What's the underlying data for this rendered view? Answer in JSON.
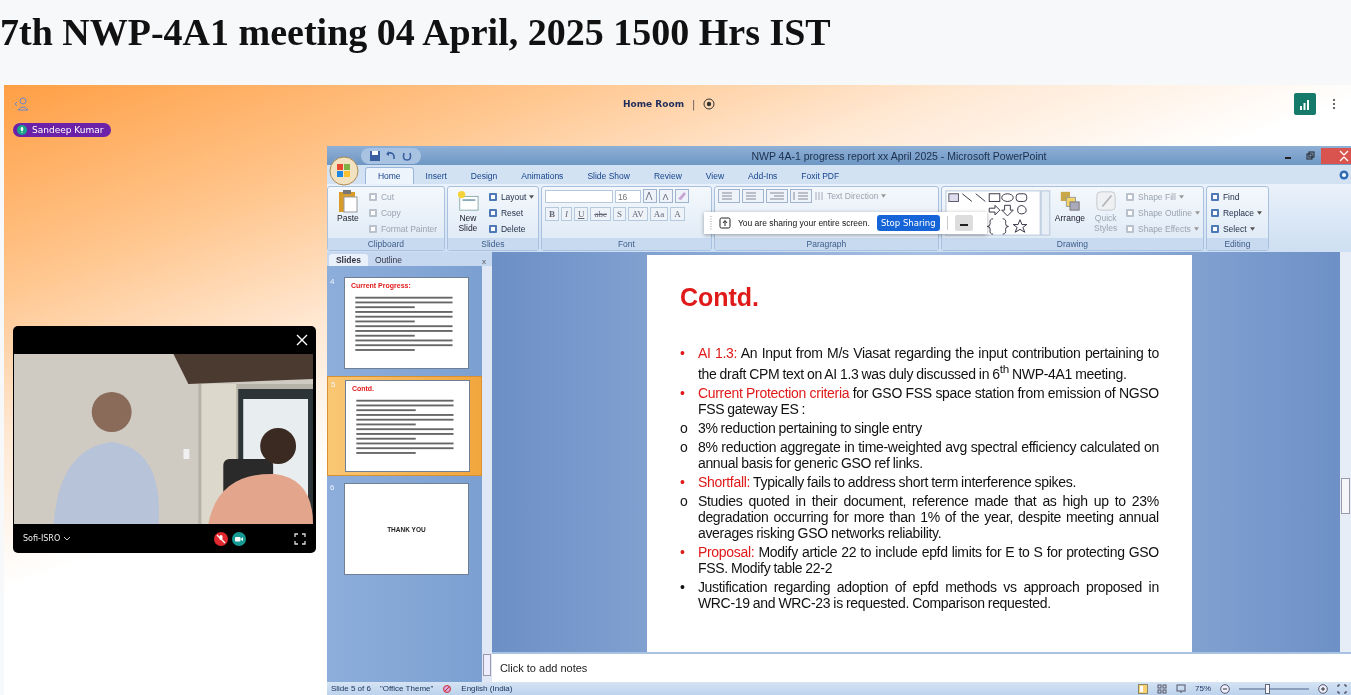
{
  "page_title": "7th NWP-4A1 meeting 04 April, 2025 1500 Hrs IST",
  "meeting": {
    "room": "Home Room",
    "separator": "|",
    "speaker": "Sandeep Kumar",
    "video_tile": {
      "name": "Sofi-ISRO",
      "mic_muted": true
    }
  },
  "powerpoint": {
    "title": "NWP 4A-1 progress report xx April 2025 - Microsoft PowerPoint",
    "tabs": [
      {
        "label": "Home",
        "selected": true
      },
      {
        "label": "Insert",
        "selected": false
      },
      {
        "label": "Design",
        "selected": false
      },
      {
        "label": "Animations",
        "selected": false
      },
      {
        "label": "Slide Show",
        "selected": false
      },
      {
        "label": "Review",
        "selected": false
      },
      {
        "label": "View",
        "selected": false
      },
      {
        "label": "Add-Ins",
        "selected": false
      },
      {
        "label": "Foxit PDF",
        "selected": false
      }
    ],
    "ribbon": [
      {
        "kind": "clipboard",
        "label": "Clipboard",
        "big": "Paste",
        "items": [
          {
            "label": "Cut",
            "disabled": true,
            "menu": false
          },
          {
            "label": "Copy",
            "disabled": true,
            "menu": false
          },
          {
            "label": "Format Painter",
            "disabled": true,
            "menu": false
          }
        ]
      },
      {
        "kind": "slides",
        "label": "Slides",
        "big": "New Slide",
        "items": [
          {
            "label": "Layout",
            "disabled": false,
            "menu": true
          },
          {
            "label": "Reset",
            "disabled": false,
            "menu": false
          },
          {
            "label": "Delete",
            "disabled": false,
            "menu": false
          }
        ]
      },
      {
        "kind": "font",
        "label": "Font",
        "size": "16",
        "buttons": [
          "B",
          "I",
          "U",
          "abe",
          "S",
          "AV",
          "Aa",
          "A"
        ]
      },
      {
        "kind": "paragraph",
        "label": "Paragraph",
        "items": [
          {
            "label": "Text Direction",
            "disabled": true,
            "menu": true
          }
        ]
      },
      {
        "kind": "drawing",
        "label": "Drawing",
        "arrange": "Arrange",
        "quick": "Quick Styles",
        "items": [
          {
            "label": "Shape Fill",
            "disabled": true,
            "menu": true
          },
          {
            "label": "Shape Outline",
            "disabled": true,
            "menu": true
          },
          {
            "label": "Shape Effects",
            "disabled": true,
            "menu": true
          }
        ]
      },
      {
        "kind": "editing",
        "label": "Editing",
        "items": [
          {
            "label": "Find",
            "disabled": false,
            "menu": false
          },
          {
            "label": "Replace",
            "disabled": false,
            "menu": true
          },
          {
            "label": "Select",
            "disabled": false,
            "menu": true
          }
        ]
      }
    ],
    "sharing": {
      "message": "You are sharing your entire screen.",
      "stop": "Stop Sharing"
    },
    "pane": {
      "tabs": [
        {
          "label": "Slides",
          "selected": true
        },
        {
          "label": "Outline",
          "selected": false
        }
      ],
      "close": "x",
      "thumbs": [
        {
          "number": "4",
          "title": "Current Progress:",
          "kind": "text",
          "selected": false
        },
        {
          "number": "5",
          "title": "Contd.",
          "kind": "text",
          "selected": true
        },
        {
          "number": "6",
          "title": "THANK YOU",
          "kind": "center",
          "selected": false
        }
      ]
    },
    "slide": {
      "title": "Contd.",
      "bullets": [
        {
          "marker": "•",
          "lead": "AI 1.3:",
          "text": "An Input from M/s Viasat regarding the input contribution pertaining to the draft CPM text on AI 1.3 was duly discussed in 6$^{th}$ NWP-4A1 meeting."
        },
        {
          "marker": "•",
          "lead": "Current Protection criteria",
          "text": "for GSO FSS space station from emission of NGSO FSS gateway ES :"
        },
        {
          "marker": "o",
          "text": "3% reduction pertaining to single entry"
        },
        {
          "marker": "o",
          "text": "8% reduction aggregate in time-weighted avg spectral efficiency calculated on annual basis for generic GSO ref links."
        },
        {
          "marker": "•",
          "lead": "Shortfall:",
          "text": "Typically fails to address short term interference spikes."
        },
        {
          "marker": "o",
          "text": "Studies quoted in their document, reference made that as high up to 23% degradation occurring for more than 1% of the year, despite meeting annual averages risking GSO networks reliability."
        },
        {
          "marker": "•",
          "lead": "Proposal:",
          "text": "Modify article 22 to include epfd limits for E to S for protecting GSO FSS. Modify table 22-2"
        },
        {
          "marker": "•",
          "text": "Justification regarding adoption of epfd methods vs approach proposed in WRC-19 and WRC-23 is requested. Comparison requested."
        }
      ]
    },
    "notes": {
      "placeholder": "Click to add notes"
    },
    "status": {
      "items": [
        "Slide 5 of 6",
        "\"Office Theme\""
      ],
      "language": "English (India)",
      "zoom": "75%",
      "level": 0.4
    }
  }
}
